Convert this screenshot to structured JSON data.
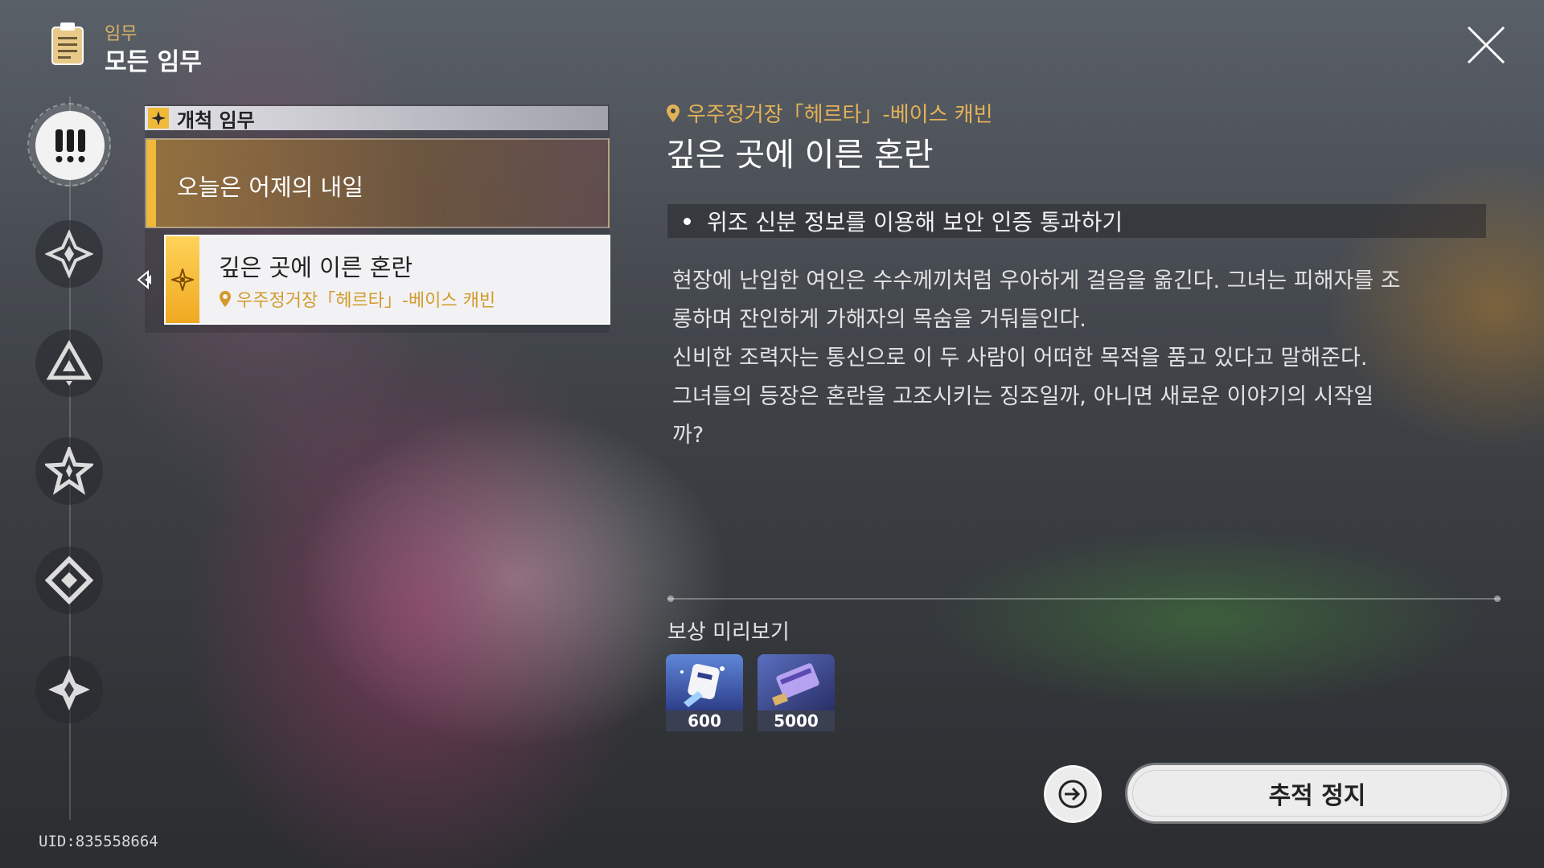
{
  "header": {
    "category": "임무",
    "title": "모든 임무"
  },
  "sidebar": {
    "categories": [
      {
        "name": "all-missions",
        "icon": "exclamation-icon",
        "active": true
      },
      {
        "name": "trailblaze",
        "icon": "compass-star-icon"
      },
      {
        "name": "story",
        "icon": "triangle-icon"
      },
      {
        "name": "companion",
        "icon": "star-icon"
      },
      {
        "name": "adventure",
        "icon": "diamond-icon"
      },
      {
        "name": "daily",
        "icon": "four-point-star-icon"
      }
    ],
    "uid": "UID:835558664"
  },
  "quest_list": {
    "group_label": "개척 임무",
    "items": [
      {
        "title": "오늘은 어제의 내일"
      },
      {
        "title": "깊은 곳에 이른 혼란",
        "location": "우주정거장「헤르타」-베이스 캐빈",
        "selected": true
      }
    ]
  },
  "detail": {
    "location": "우주정거장「헤르타」-베이스 캐빈",
    "title": "깊은 곳에 이른 혼란",
    "objective": "위조 신분 정보를 이용해 보안 인증 통과하기",
    "description": [
      "현장에 난입한 여인은 수수께끼처럼 우아하게 걸음을 옮긴다. 그녀는 피해자를 조",
      "롱하며 잔인하게 가해자의 목숨을 거둬들인다.",
      "신비한 조력자는 통신으로 이 두 사람이 어떠한 목적을 품고 있다고 말해준다.",
      "그녀들의 등장은 혼란을 고조시키는 징조일까, 아니면 새로운 이야기의 시작일",
      "까?"
    ],
    "reward_title": "보상 미리보기",
    "rewards": [
      {
        "icon": "trailblaze-exp-icon",
        "qty": "600"
      },
      {
        "icon": "credit-card-icon",
        "qty": "5000"
      }
    ]
  },
  "buttons": {
    "navigate_icon": "navigate-arrow-icon",
    "track_label": "추적 정지"
  },
  "colors": {
    "accent_gold": "#f0b93a",
    "location_text": "#e3b256"
  }
}
